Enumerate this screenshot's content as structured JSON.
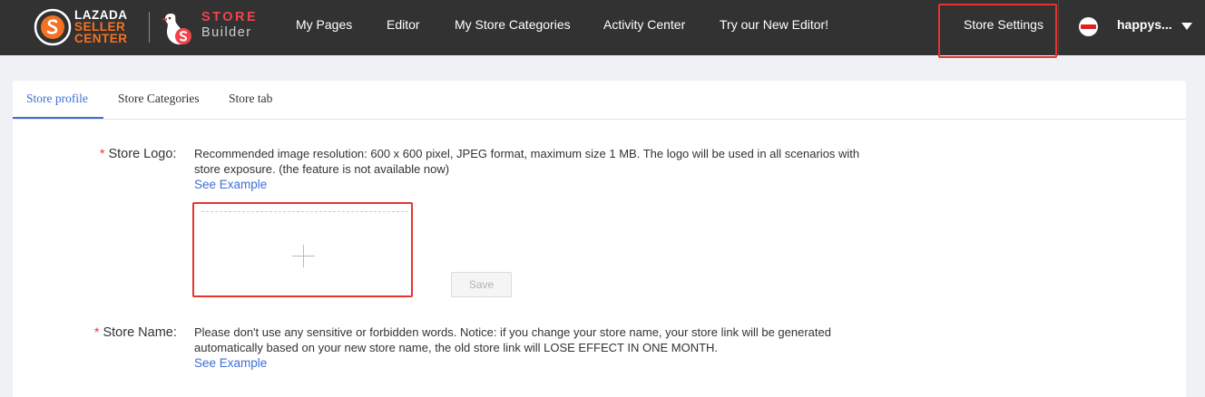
{
  "brand": {
    "lazada_line1": "LAZADA",
    "lazada_line2": "SELLER",
    "lazada_line3": "CENTER",
    "store_line1": "STORE",
    "store_line2": "Builder"
  },
  "nav": {
    "items": [
      {
        "label": "My Pages"
      },
      {
        "label": "Editor"
      },
      {
        "label": "My Store Categories"
      },
      {
        "label": "Activity Center"
      },
      {
        "label": "Try our New Editor!"
      }
    ],
    "settings_label": "Store Settings",
    "username": "happys..."
  },
  "tabs": [
    {
      "label": "Store profile",
      "active": true
    },
    {
      "label": "Store Categories",
      "active": false
    },
    {
      "label": "Store tab",
      "active": false
    }
  ],
  "form": {
    "required_mark": "*",
    "logo": {
      "label": "Store Logo:",
      "description": "Recommended image resolution: 600 x 600 pixel, JPEG format, maximum size 1 MB. The logo will be used in all scenarios with store exposure. (the feature is not available now)",
      "see_example": "See Example",
      "save_label": "Save"
    },
    "name": {
      "label": "Store Name:",
      "description": "Please don't use any sensitive or forbidden words. Notice: if you change your store name, your store link will be generated automatically based on your new store name, the old store link will LOSE EFFECT IN ONE MONTH.",
      "see_example": "See Example"
    }
  },
  "colors": {
    "topbar": "#323232",
    "accent_orange": "#f57224",
    "highlight_red": "#e8332e",
    "link_blue": "#3c6fd6"
  }
}
